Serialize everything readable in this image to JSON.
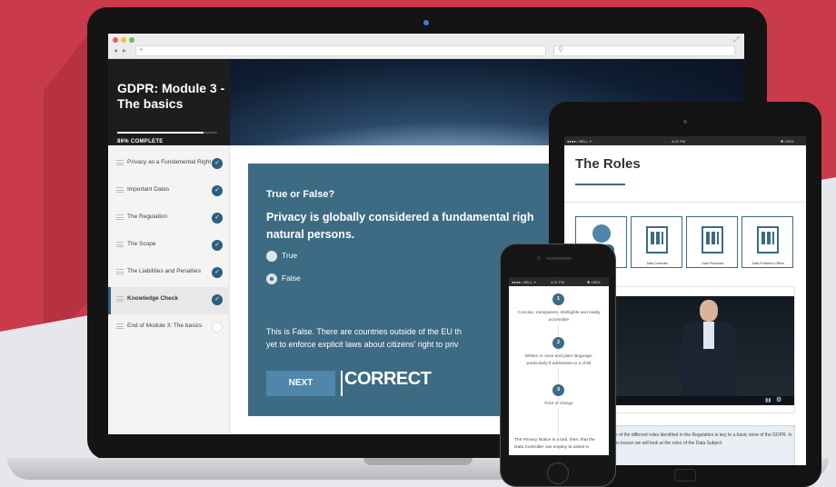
{
  "course": {
    "title": "GDPR: Module 3 - The basics",
    "progress_label": "86% COMPLETE",
    "progress_value": 0.86,
    "items": [
      {
        "label": "Privacy as a Fundamental Right",
        "status": "complete"
      },
      {
        "label": "Important Dates",
        "status": "complete"
      },
      {
        "label": "The Regulation",
        "status": "complete"
      },
      {
        "label": "The Scope",
        "status": "complete"
      },
      {
        "label": "The Liabilities and Penalties",
        "status": "complete"
      },
      {
        "label": "Knowledge Check",
        "status": "complete"
      },
      {
        "label": "End of Module 3: The basics",
        "status": "incomplete"
      }
    ],
    "active_item": "Knowledge Check"
  },
  "quiz": {
    "kicker": "True or False?",
    "question": "Privacy is globally considered a fundamental righ natural persons.",
    "question_line1": "Privacy is globally considered a fundamental righ",
    "question_line2": "natural persons.",
    "options": [
      {
        "label": "True",
        "selected": false
      },
      {
        "label": "False",
        "selected": true
      }
    ],
    "explanation_line1": "This is False. There are countries outside of the EU th",
    "explanation_line2": "yet to enforce explicit laws about citizens' right to priv",
    "next_label": "NEXT",
    "result_label": "CORRECT"
  },
  "tablet": {
    "status_carrier": "●●●●○ BELL ᯤ",
    "status_time": "4:21 PM",
    "status_battery": "✱ 100%",
    "title": "The Roles",
    "roles": [
      "",
      "Data Controller",
      "Data Processor",
      "Data Protection Officer"
    ],
    "info_text": "ge of the different roles identified in the Regulation is key to a basic onne of the GDPR. In this lesson we will look at the roles of the Data Subject"
  },
  "phone": {
    "status_carrier": "●●●●○ BELL ᯤ",
    "status_time": "4:21 PM",
    "status_battery": "✱ 100%",
    "steps": [
      {
        "num": "1",
        "text": "Concise, transparent, intelligible and easily accessible"
      },
      {
        "num": "2",
        "text": "Written in clear and plain language, particularly if addresses to a child"
      },
      {
        "num": "3",
        "text": "Free of charge"
      }
    ],
    "note": "The Privacy Notice is a tool, then, that the Data Controller can employ to assist in"
  },
  "colors": {
    "accent": "#3d6b84",
    "brand_red": "#c93a4b",
    "button": "#4f86aa"
  }
}
